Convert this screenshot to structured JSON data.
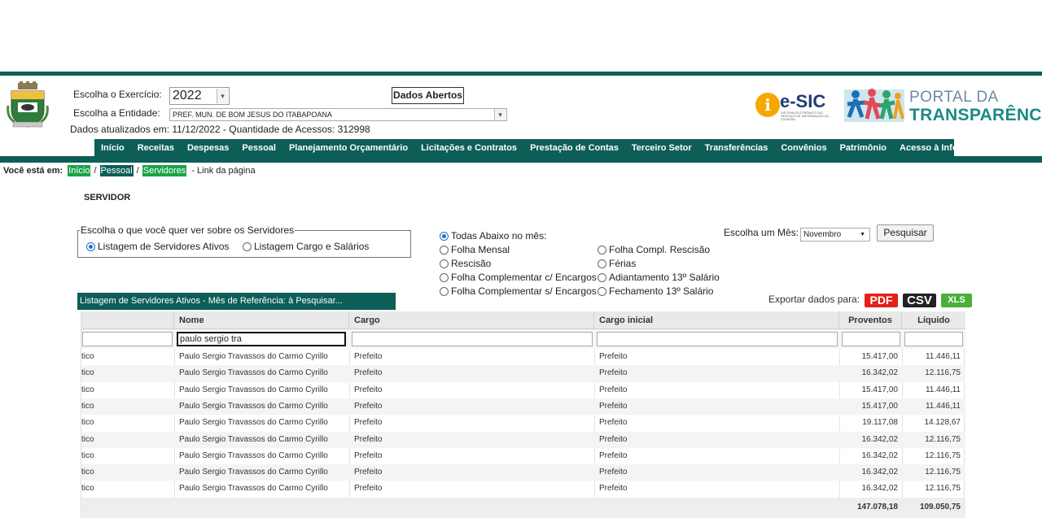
{
  "header": {
    "exercicio_label": "Escolha o Exercício:",
    "exercicio_value": "2022",
    "entidade_label": "Escolha a Entidade:",
    "entidade_value": "PREF. MUN. DE BOM JESUS DO ITABAPOANA",
    "updated_text": "Dados atualizados em: 11/12/2022 - Quantidade de Acessos: 312998",
    "dados_abertos": "Dados Abertos",
    "esic_logo": "e-SIC",
    "esic_sub": "SISTEMA ELETRÔNICO DO SERVIÇO DE INFORMAÇÃO AO CIDADÃO",
    "portal_line1": "PORTAL DA",
    "portal_line2": "TRANSPARÊNCIA"
  },
  "nav": [
    "Início",
    "Receitas",
    "Despesas",
    "Pessoal",
    "Planejamento Orçamentário",
    "Licitações e Contratos",
    "Prestação de Contas",
    "Terceiro Setor",
    "Transferências",
    "Convênios",
    "Patrimônio",
    "Acesso à Informação"
  ],
  "breadcrumb": {
    "lead": "Você está em:",
    "items": [
      "Início",
      "Pessoal",
      "Servidores"
    ],
    "link": "- Link da página"
  },
  "page_title": "SERVIDOR",
  "choose": {
    "legend": "Escolha o que você quer ver sobre os Servidores",
    "opt1": "Listagem de Servidores Ativos",
    "opt2": "Listagem Cargo e Salários"
  },
  "folha_options": {
    "todas": "Todas Abaixo no mês:",
    "col1": [
      "Folha Mensal",
      "Rescisão",
      "Folha Complementar c/ Encargos",
      "Folha Complementar s/ Encargos"
    ],
    "col2": [
      "Folha Compl. Rescisão",
      "Férias",
      "Adiantamento 13º Salário",
      "Fechamento 13º Salário"
    ]
  },
  "month": {
    "label": "Escolha um Mês:",
    "value": "Novembro",
    "search_button": "Pesquisar"
  },
  "export": {
    "label": "Exportar dados para:",
    "pdf": "PDF",
    "csv": "CSV",
    "xls": "XLS"
  },
  "grid": {
    "title": "Listagem de Servidores Ativos - Mês de Referência: à Pesquisar...",
    "columns": [
      "",
      "Nome",
      "Cargo",
      "Cargo inicial",
      "Proventos",
      "Líquido"
    ],
    "filter_nome": "paulo sergio tra",
    "rows": [
      {
        "tipo": "tico",
        "nome": "Paulo Sergio Travassos do Carmo Cyrillo",
        "cargo": "Prefeito",
        "cargo_inicial": "Prefeito",
        "proventos": "15.417,00",
        "liquido": "11.446,11"
      },
      {
        "tipo": "tico",
        "nome": "Paulo Sergio Travassos do Carmo Cyrillo",
        "cargo": "Prefeito",
        "cargo_inicial": "Prefeito",
        "proventos": "16.342,02",
        "liquido": "12.116,75"
      },
      {
        "tipo": "tico",
        "nome": "Paulo Sergio Travassos do Carmo Cyrillo",
        "cargo": "Prefeito",
        "cargo_inicial": "Prefeito",
        "proventos": "15.417,00",
        "liquido": "11.446,11"
      },
      {
        "tipo": "tico",
        "nome": "Paulo Sergio Travassos do Carmo Cyrillo",
        "cargo": "Prefeito",
        "cargo_inicial": "Prefeito",
        "proventos": "15.417,00",
        "liquido": "11.446,11"
      },
      {
        "tipo": "tico",
        "nome": "Paulo Sergio Travassos do Carmo Cyrillo",
        "cargo": "Prefeito",
        "cargo_inicial": "Prefeito",
        "proventos": "19.117,08",
        "liquido": "14.128,67"
      },
      {
        "tipo": "tico",
        "nome": "Paulo Sergio Travassos do Carmo Cyrillo",
        "cargo": "Prefeito",
        "cargo_inicial": "Prefeito",
        "proventos": "16.342,02",
        "liquido": "12.116,75"
      },
      {
        "tipo": "tico",
        "nome": "Paulo Sergio Travassos do Carmo Cyrillo",
        "cargo": "Prefeito",
        "cargo_inicial": "Prefeito",
        "proventos": "16.342,02",
        "liquido": "12.116,75"
      },
      {
        "tipo": "tico",
        "nome": "Paulo Sergio Travassos do Carmo Cyrillo",
        "cargo": "Prefeito",
        "cargo_inicial": "Prefeito",
        "proventos": "16.342,02",
        "liquido": "12.116,75"
      },
      {
        "tipo": "tico",
        "nome": "Paulo Sergio Travassos do Carmo Cyrillo",
        "cargo": "Prefeito",
        "cargo_inicial": "Prefeito",
        "proventos": "16.342,02",
        "liquido": "12.116,75"
      }
    ],
    "total_proventos": "147.078,18",
    "total_liquido": "109.050,75"
  }
}
